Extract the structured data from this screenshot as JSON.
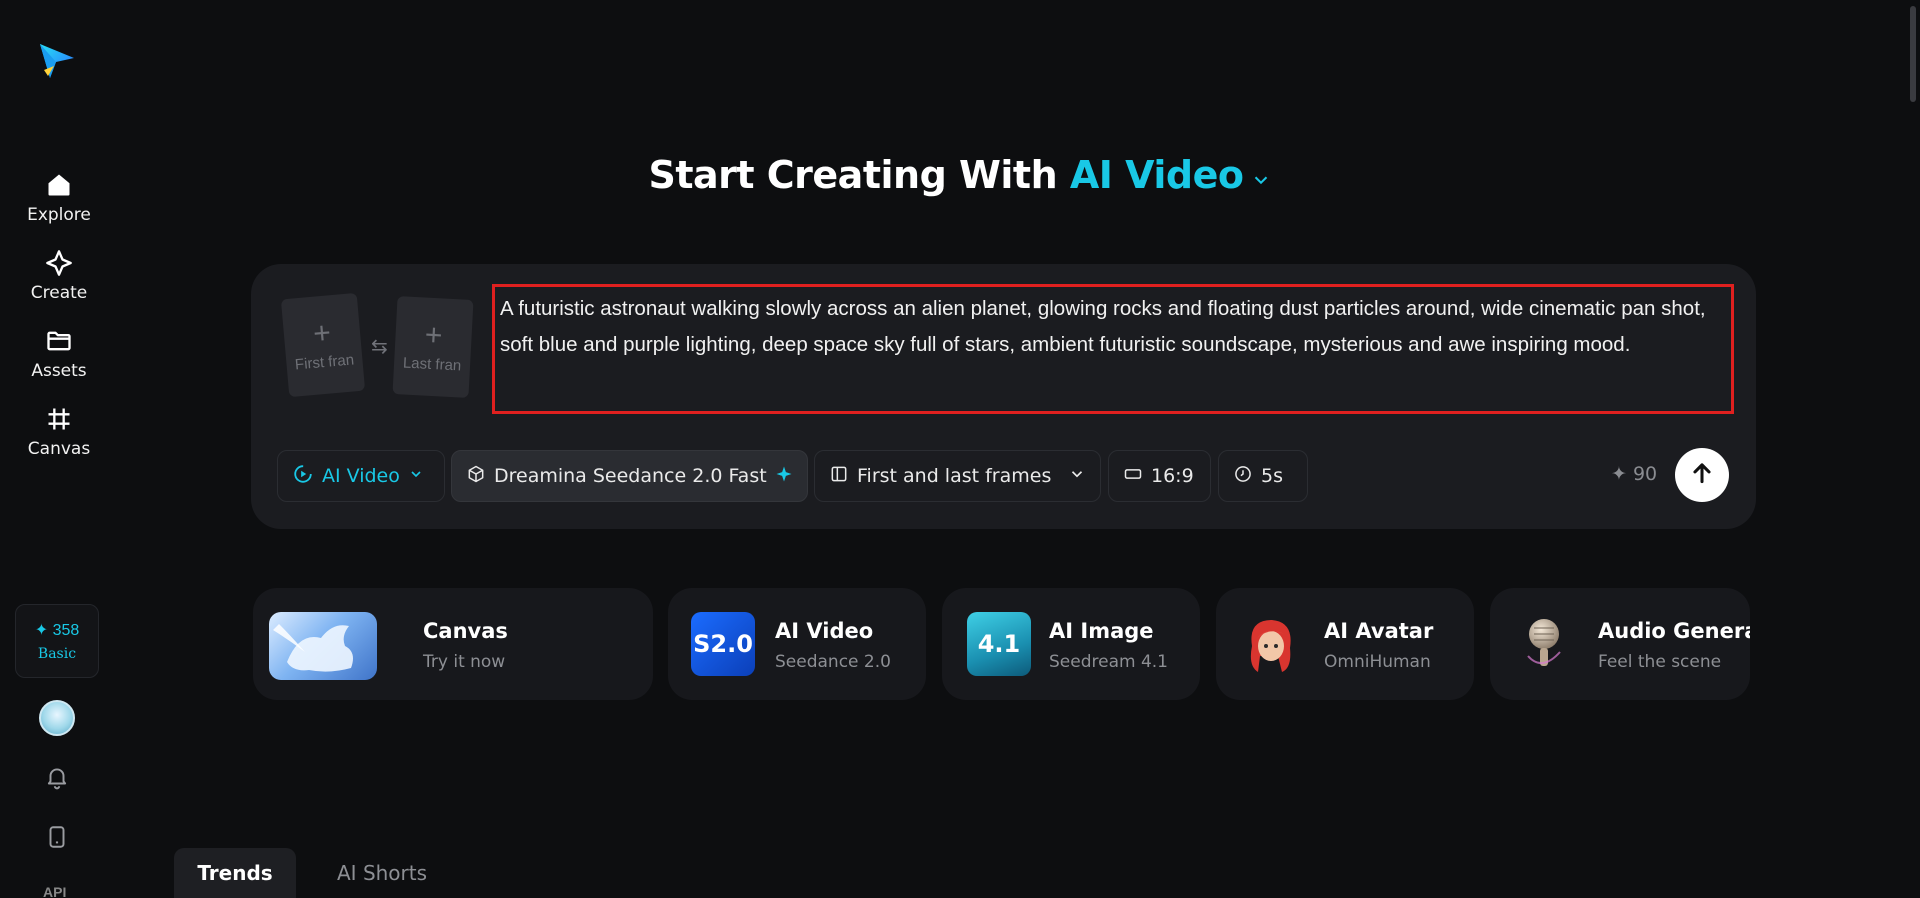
{
  "sidebar": {
    "items": [
      {
        "label": "Explore",
        "icon": "home-icon"
      },
      {
        "label": "Create",
        "icon": "sparkle-icon"
      },
      {
        "label": "Assets",
        "icon": "folder-icon"
      },
      {
        "label": "Canvas",
        "icon": "canvas-grid-icon"
      }
    ],
    "credits": {
      "value": "✦ 358",
      "tier": "Basic"
    },
    "api_label": "API"
  },
  "header": {
    "title_prefix": "Start Creating With ",
    "title_accent": "AI Video"
  },
  "prompt": {
    "first_frame": "First fran",
    "last_frame": "Last fran",
    "text": "A futuristic astronaut walking slowly across an alien planet, glowing rocks and floating dust particles around, wide cinematic pan shot, soft blue and purple lighting, deep space sky full of stars, ambient futuristic soundscape, mysterious and awe inspiring mood."
  },
  "toolbar": {
    "mode": "AI Video",
    "model": "Dreamina Seedance 2.0 Fast",
    "frames": "First and last frames",
    "ratio": "16:9",
    "duration": "5s",
    "cost": "✦ 90"
  },
  "features": [
    {
      "title": "Canvas",
      "sub": "Try it now"
    },
    {
      "title": "AI Video",
      "sub": "Seedance 2.0",
      "badge": "S2.0"
    },
    {
      "title": "AI Image",
      "sub": "Seedream 4.1",
      "badge": "4.1"
    },
    {
      "title": "AI Avatar",
      "sub": "OmniHuman"
    },
    {
      "title": "Audio Genera",
      "sub": "Feel the scene"
    }
  ],
  "tabs": [
    {
      "label": "Trends"
    },
    {
      "label": "AI Shorts"
    }
  ],
  "colors": {
    "accent": "#19c8e6",
    "highlight": "#e0201f"
  }
}
